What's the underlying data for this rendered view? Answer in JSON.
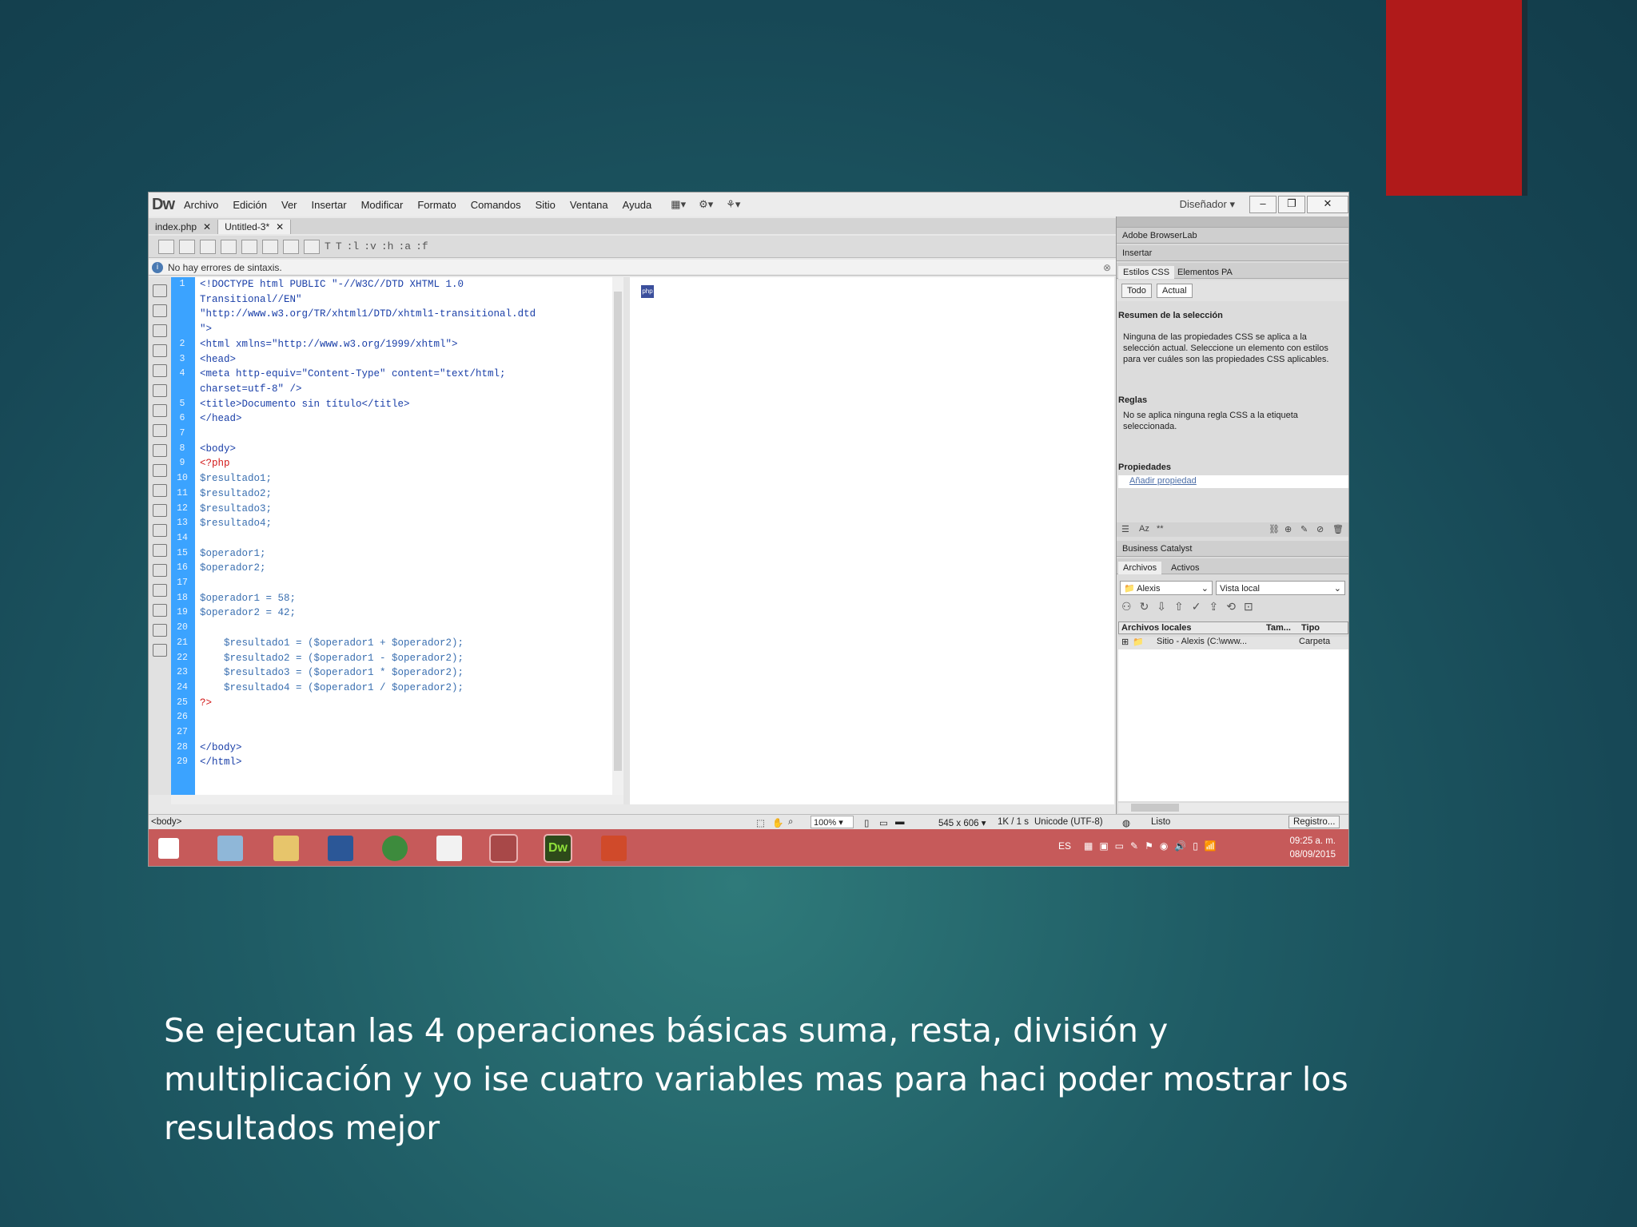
{
  "slide": {
    "caption": "Se ejecutan las 4 operaciones básicas suma, resta, división y multiplicación y yo ise cuatro variables mas para haci poder mostrar los resultados mejor"
  },
  "app": {
    "logo": "Dw",
    "menu": [
      "Archivo",
      "Edición",
      "Ver",
      "Insertar",
      "Modificar",
      "Formato",
      "Comandos",
      "Sitio",
      "Ventana",
      "Ayuda"
    ],
    "workspace": "Diseñador",
    "tabs": [
      {
        "label": "index.php"
      },
      {
        "label": "Untitled-3*"
      }
    ],
    "syntax_status": "No hay errores de sintaxis.",
    "toolbar_labels": [
      "T",
      "T",
      ":l",
      ":v",
      ":h",
      ":a",
      ":f"
    ]
  },
  "editor": {
    "lines": [
      {
        "n": "1",
        "text": "<!DOCTYPE html PUBLIC \"-//W3C//DTD XHTML 1.0",
        "kind": "tag"
      },
      {
        "n": "",
        "text": "Transitional//EN\"",
        "kind": "tag"
      },
      {
        "n": "",
        "text": "\"http://www.w3.org/TR/xhtml1/DTD/xhtml1-transitional.dtd",
        "kind": "tag"
      },
      {
        "n": "",
        "text": "\">",
        "kind": "tag"
      },
      {
        "n": "2",
        "text": "<html xmlns=\"http://www.w3.org/1999/xhtml\">",
        "kind": "tag"
      },
      {
        "n": "3",
        "text": "<head>",
        "kind": "tag"
      },
      {
        "n": "4",
        "text": "<meta http-equiv=\"Content-Type\" content=\"text/html;",
        "kind": "tag"
      },
      {
        "n": "",
        "text": "charset=utf-8\" />",
        "kind": "tag"
      },
      {
        "n": "5",
        "text": "<title>Documento sin título</title>",
        "kind": "tag"
      },
      {
        "n": "6",
        "text": "</head>",
        "kind": "tag"
      },
      {
        "n": "7",
        "text": "",
        "kind": "tag"
      },
      {
        "n": "8",
        "text": "<body>",
        "kind": "tag"
      },
      {
        "n": "9",
        "text": "<?php",
        "kind": "php"
      },
      {
        "n": "10",
        "text": "$resultado1;",
        "kind": "var"
      },
      {
        "n": "11",
        "text": "$resultado2;",
        "kind": "var"
      },
      {
        "n": "12",
        "text": "$resultado3;",
        "kind": "var"
      },
      {
        "n": "13",
        "text": "$resultado4;",
        "kind": "var"
      },
      {
        "n": "14",
        "text": "",
        "kind": "var"
      },
      {
        "n": "15",
        "text": "$operador1;",
        "kind": "var"
      },
      {
        "n": "16",
        "text": "$operador2;",
        "kind": "var"
      },
      {
        "n": "17",
        "text": "",
        "kind": "var"
      },
      {
        "n": "18",
        "text": "$operador1 = 58;",
        "kind": "var"
      },
      {
        "n": "19",
        "text": "$operador2 = 42;",
        "kind": "var"
      },
      {
        "n": "20",
        "text": "",
        "kind": "var"
      },
      {
        "n": "21",
        "text": "    $resultado1 = ($operador1 + $operador2);",
        "kind": "var"
      },
      {
        "n": "22",
        "text": "    $resultado2 = ($operador1 - $operador2);",
        "kind": "var"
      },
      {
        "n": "23",
        "text": "    $resultado3 = ($operador1 * $operador2);",
        "kind": "var"
      },
      {
        "n": "24",
        "text": "    $resultado4 = ($operador1 / $operador2);",
        "kind": "var"
      },
      {
        "n": "25",
        "text": "?>",
        "kind": "php"
      },
      {
        "n": "26",
        "text": "",
        "kind": "tag"
      },
      {
        "n": "27",
        "text": "",
        "kind": "tag"
      },
      {
        "n": "28",
        "text": "</body>",
        "kind": "tag"
      },
      {
        "n": "29",
        "text": "</html>",
        "kind": "tag"
      }
    ]
  },
  "statusbar": {
    "tag": "<body>",
    "zoom": "100%",
    "size": "545 x 606",
    "download": "1K / 1 s",
    "encoding": "Unicode (UTF-8)",
    "ready": "Listo",
    "log_button": "Registro..."
  },
  "panels": {
    "browserlab": "Adobe BrowserLab",
    "insert": "Insertar",
    "css_tab": "Estilos CSS",
    "ap_tab": "Elementos PA",
    "all_btn": "Todo",
    "current_btn": "Actual",
    "summary_title": "Resumen de la selección",
    "summary_text": "Ninguna de las propiedades CSS se aplica a la selección actual.  Seleccione un elemento con estilos para ver cuáles son las propiedades CSS aplicables.",
    "rules_title": "Reglas",
    "rules_text": "No se aplica ninguna regla CSS a la etiqueta seleccionada.",
    "props_title": "Propiedades",
    "add_prop": "Añadir propiedad",
    "business": "Business Catalyst",
    "files_tab": "Archivos",
    "assets_tab": "Activos",
    "site_select": "Alexis",
    "view_select": "Vista local",
    "col_local": "Archivos locales",
    "col_size": "Tam...",
    "col_type": "Tipo",
    "site_row": "Sitio - Alexis (C:\\www...",
    "site_row_type": "Carpeta"
  },
  "taskbar": {
    "lang": "ES",
    "time": "09:25 a. m.",
    "date": "08/09/2015"
  }
}
